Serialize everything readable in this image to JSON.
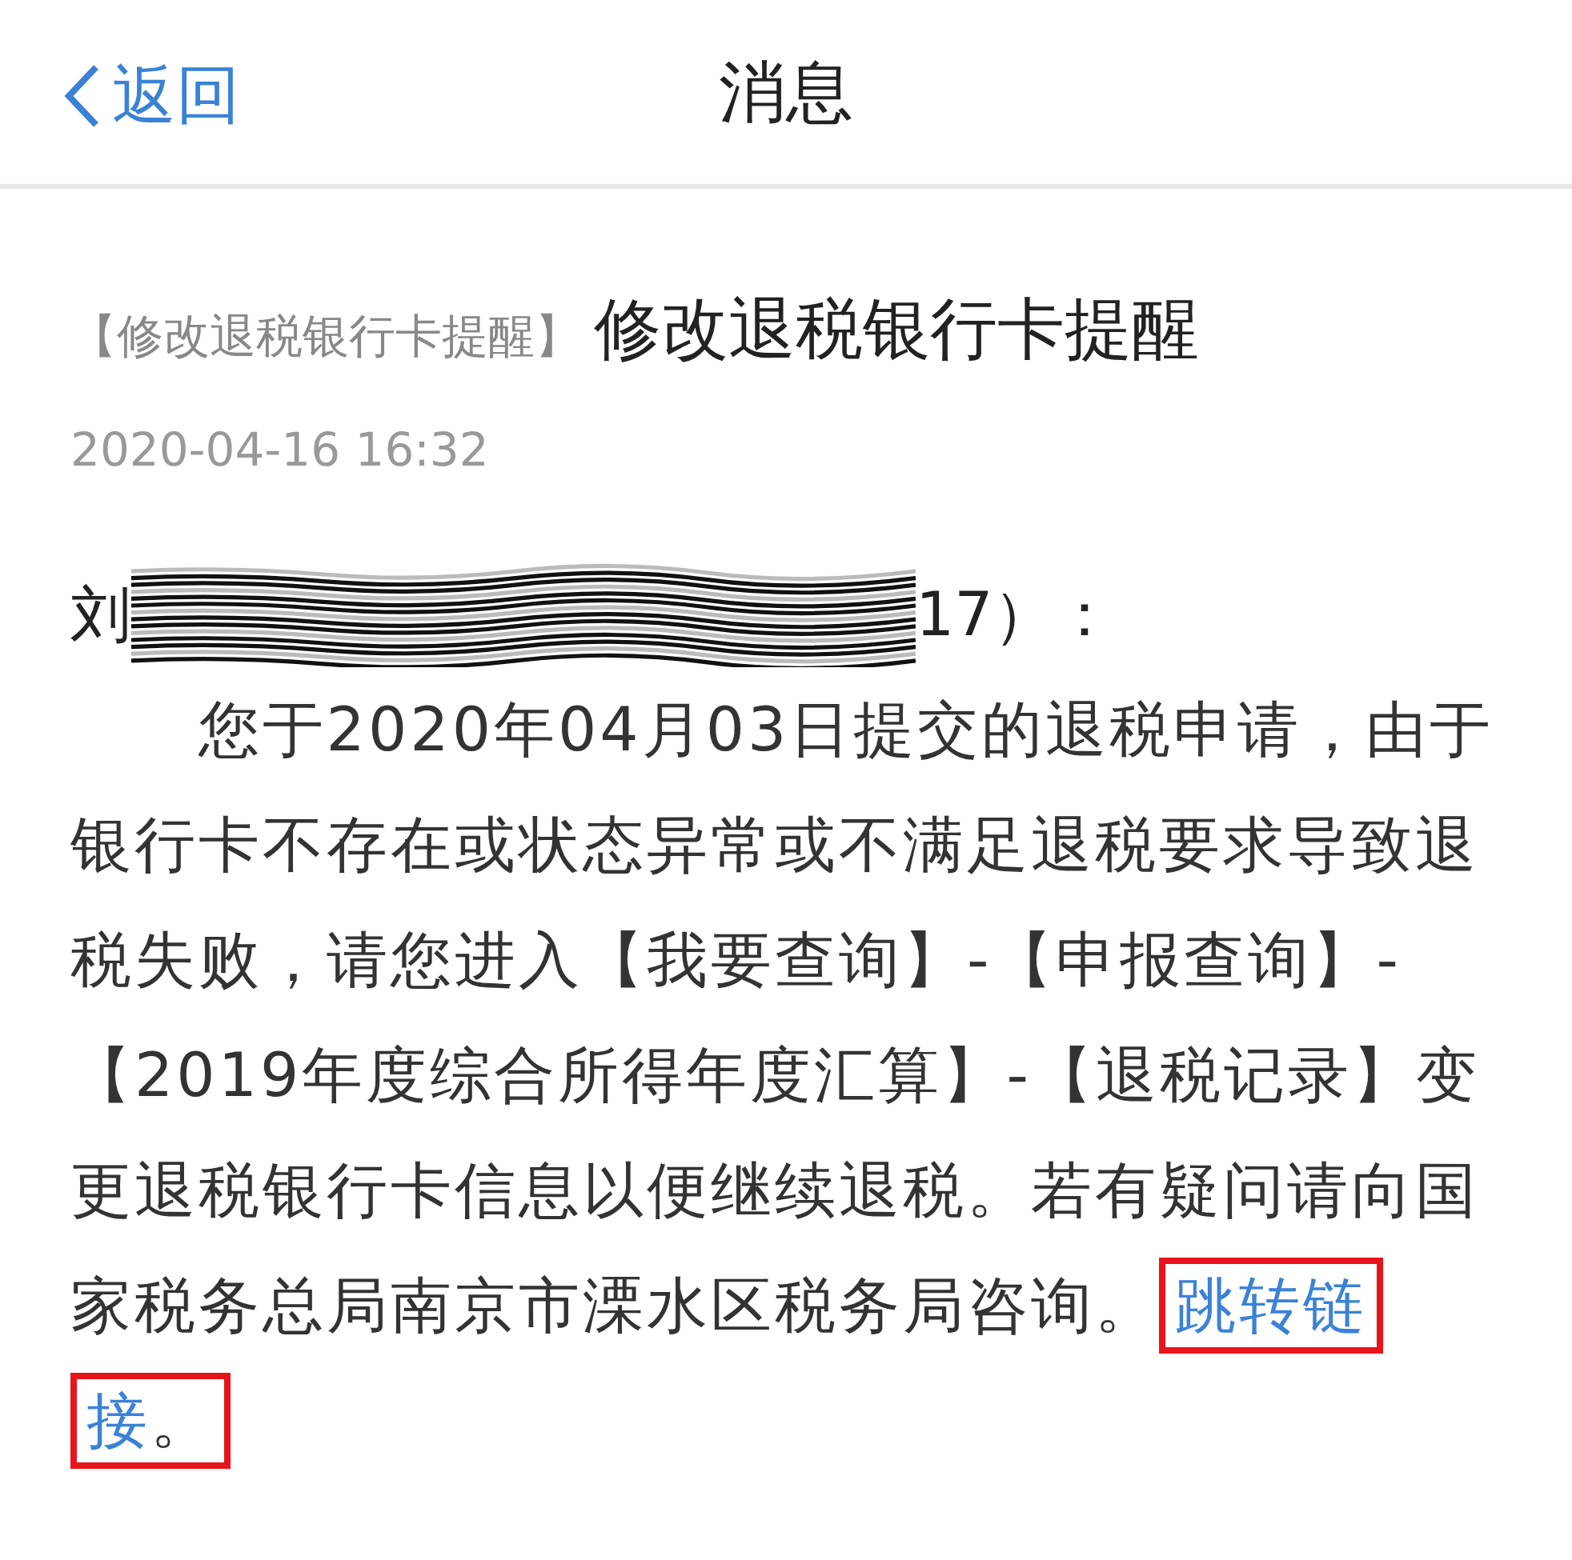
{
  "nav": {
    "back_label": "返回",
    "title": "消息"
  },
  "message": {
    "tag": "【修改退税银行卡提醒】",
    "title": "修改退税银行卡提醒",
    "time": "2020-04-16 16:32",
    "greeting_start": "刘",
    "greeting_end": "17）：",
    "body": "您于2020年04月03日提交的退税申请，由于银行卡不存在或状态异常或不满足退税要求导致退税失败，请您进入【我要查询】-【申报查询】-【2019年度综合所得年度汇算】-【退税记录】变更退税银行卡信息以便继续退税。若有疑问请向国家税务总局南京市溧水区税务局咨询。",
    "link_lines": [
      "跳转链",
      "接"
    ],
    "after_link": "。"
  }
}
